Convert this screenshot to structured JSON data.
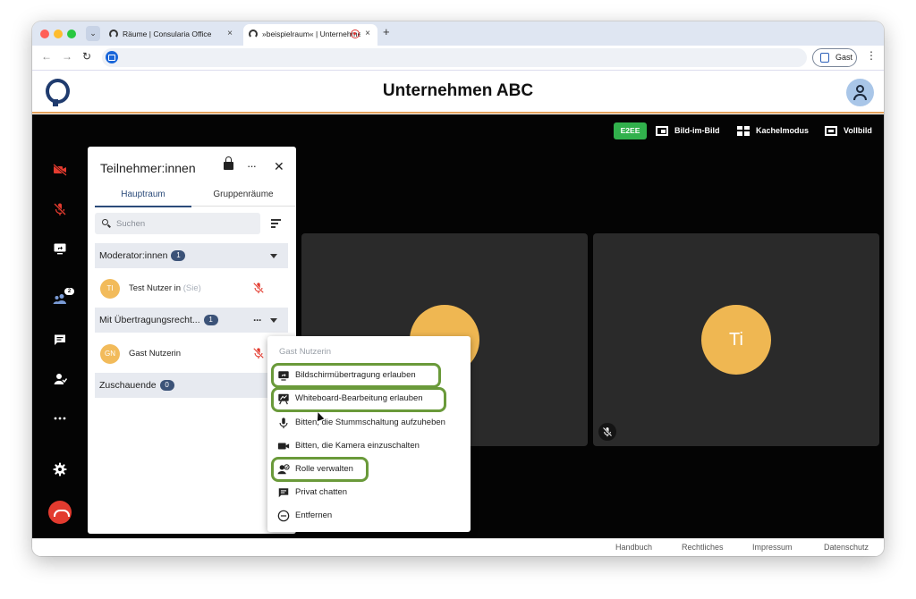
{
  "browser": {
    "tabs": [
      {
        "title": "Räume | Consularia Office",
        "close": "×"
      },
      {
        "title": "»beispielraum« | Unternehmen ABC",
        "close": "×"
      }
    ],
    "new_tab": "+",
    "tab_menu": "⌄",
    "nav": {
      "back": "←",
      "forward": "→",
      "reload": "↻"
    },
    "profile_label": "Gast",
    "menu": "⋮"
  },
  "app": {
    "title": "Unternehmen ABC"
  },
  "stage_controls": {
    "e2ee": "E2EE",
    "pip": "Bild-im-Bild",
    "tile": "Kachelmodus",
    "fullscreen": "Vollbild"
  },
  "toolbar": {
    "participants_badge": "2"
  },
  "panel": {
    "title": "Teilnehmer:innen",
    "more": "···",
    "close": "✕",
    "tabs": [
      "Hauptraum",
      "Gruppenräume"
    ],
    "search_placeholder": "Suchen",
    "groups": [
      {
        "label": "Moderator:innen",
        "count": "1"
      },
      {
        "label": "Mit Übertragungsrecht...",
        "count": "1",
        "more": "···"
      },
      {
        "label": "Zuschauende",
        "count": "0"
      }
    ],
    "participants": [
      {
        "initials": "TI",
        "name": "Test Nutzer in",
        "suffix": "(Sie)"
      },
      {
        "initials": "GN",
        "name": "Gast Nutzerin",
        "suffix": ""
      }
    ]
  },
  "tiles": [
    {
      "initials": ""
    },
    {
      "initials": "Ti"
    }
  ],
  "context_menu": {
    "header": "Gast Nutzerin",
    "items": [
      {
        "label": "Bildschirmübertragung erlauben",
        "icon": "screen-share-icon"
      },
      {
        "label": "Whiteboard-Bearbeitung erlauben",
        "icon": "whiteboard-icon"
      },
      {
        "label": "Bitten, die Stummschaltung aufzuheben",
        "icon": "microphone-icon"
      },
      {
        "label": "Bitten, die Kamera einzuschalten",
        "icon": "camera-icon"
      },
      {
        "label": "Rolle verwalten",
        "icon": "manage-role-icon"
      },
      {
        "label": "Privat chatten",
        "icon": "chat-icon"
      },
      {
        "label": "Entfernen",
        "icon": "remove-icon"
      }
    ],
    "highlight_color": "#6a9a3a"
  },
  "footer": {
    "links": [
      "Handbuch",
      "Rechtliches",
      "Impressum",
      "Datenschutz"
    ]
  },
  "colors": {
    "accent_orange": "#e4a25c",
    "navy": "#1f3b6e",
    "e2ee_green": "#31b14c",
    "muted_red": "#e33b2f",
    "avatar_yellow": "#efb752"
  }
}
